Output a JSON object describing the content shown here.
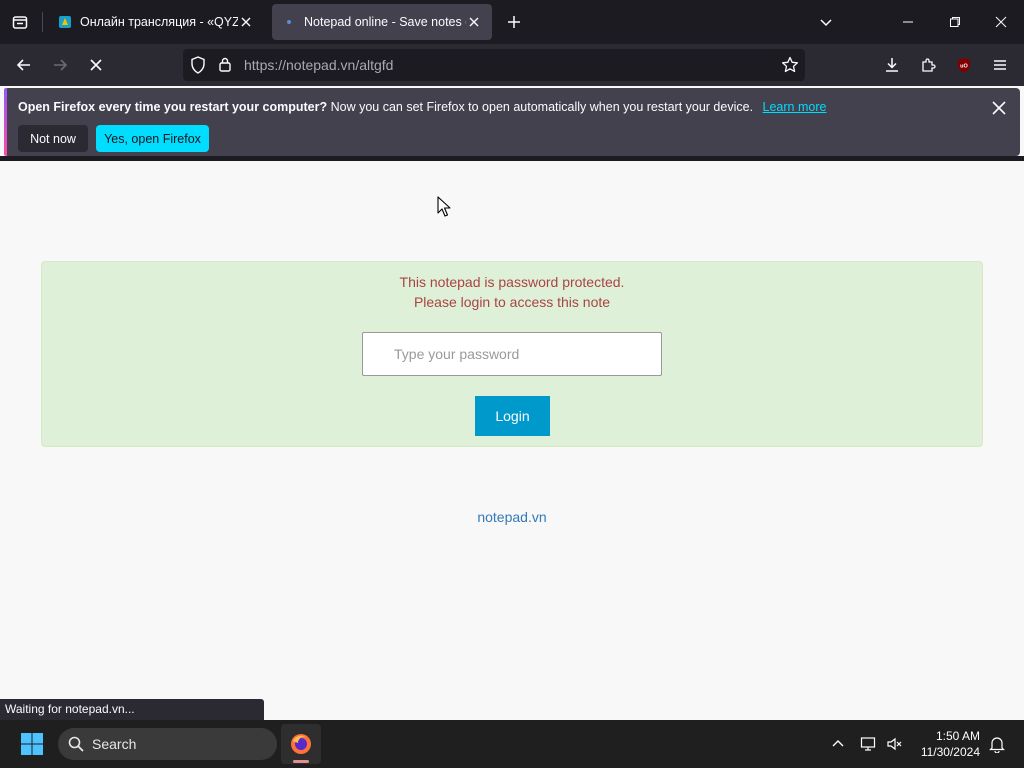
{
  "browser": {
    "tabs": [
      {
        "title": "Онлайн трансляция - «QYZYL"
      },
      {
        "title": "Notepad online - Save notes or"
      }
    ],
    "url_host": "https://notepad.vn",
    "url_path": "/altgfd"
  },
  "notification": {
    "bold_text": "Open Firefox every time you restart your computer?",
    "text": "Now you can set Firefox to open automatically when you restart your device.",
    "link": "Learn more",
    "not_now": "Not now",
    "yes": "Yes, open Firefox"
  },
  "page": {
    "message_line1": "This notepad is password protected.",
    "message_line2": "Please login to access this note",
    "password_placeholder": "Type your password",
    "login_label": "Login",
    "footer_link": "notepad.vn",
    "colors": {
      "panel_bg": "#dff0d8",
      "message": "#a94442",
      "button": "#0099cc",
      "link": "#337ab7"
    }
  },
  "status_bar": {
    "text": "Waiting for notepad.vn..."
  },
  "taskbar": {
    "search_label": "Search",
    "time": "1:50 AM",
    "date": "11/30/2024"
  }
}
